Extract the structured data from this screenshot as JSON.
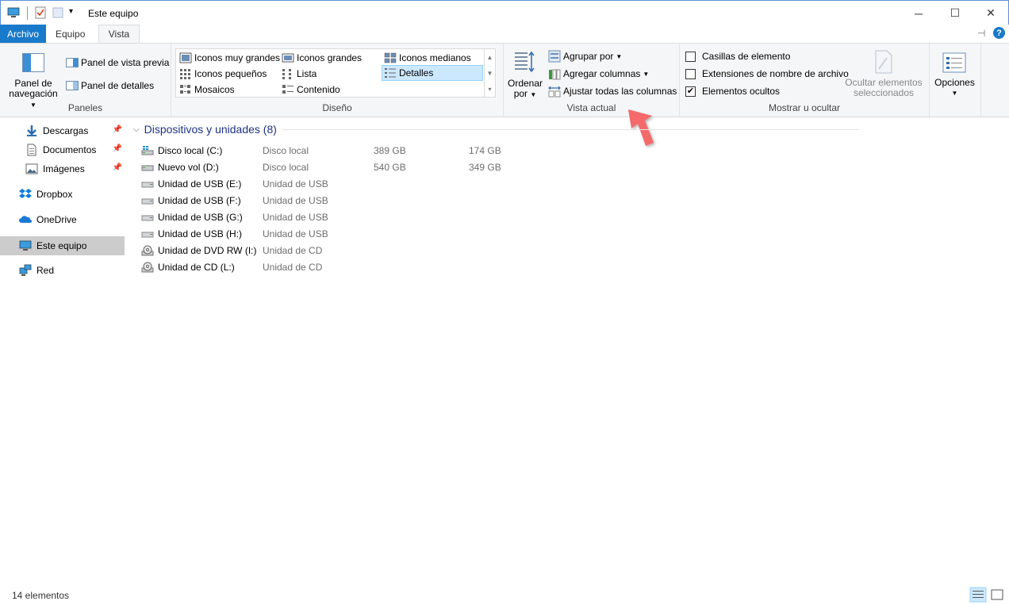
{
  "window": {
    "title": "Este equipo"
  },
  "tabs": [
    {
      "label": "Archivo"
    },
    {
      "label": "Equipo"
    },
    {
      "label": "Vista"
    }
  ],
  "ribbon": {
    "panes": {
      "nav_pane_label_1": "Panel de",
      "nav_pane_label_2": "navegación",
      "preview_pane": "Panel de vista previa",
      "details_pane": "Panel de detalles",
      "group_label": "Paneles"
    },
    "layout": {
      "items": [
        "Iconos muy grandes",
        "Iconos grandes",
        "Iconos medianos",
        "Iconos pequeños",
        "Lista",
        "Detalles",
        "Mosaicos",
        "Contenido"
      ],
      "selected": "Detalles",
      "group_label": "Diseño"
    },
    "current_view": {
      "sort_label_1": "Ordenar",
      "sort_label_2": "por",
      "group_by": "Agrupar por",
      "add_columns": "Agregar columnas",
      "fit_columns": "Ajustar todas las columnas",
      "group_label": "Vista actual"
    },
    "show_hide": {
      "item_checkboxes": {
        "label": "Casillas de elemento",
        "checked": false
      },
      "file_extensions": {
        "label": "Extensiones de nombre de archivo",
        "checked": false
      },
      "hidden_items": {
        "label": "Elementos ocultos",
        "checked": true
      },
      "hide_selected_1": "Ocultar elementos",
      "hide_selected_2": "seleccionados",
      "group_label": "Mostrar u ocultar"
    },
    "options": {
      "label": "Opciones"
    }
  },
  "nav": {
    "items": [
      {
        "label": "Descargas",
        "icon": "download-icon",
        "pinned": true
      },
      {
        "label": "Documentos",
        "icon": "document-icon",
        "pinned": true
      },
      {
        "label": "Imágenes",
        "icon": "image-icon",
        "pinned": true
      },
      {
        "label": "Dropbox",
        "icon": "dropbox-icon"
      },
      {
        "label": "OneDrive",
        "icon": "cloud-icon"
      },
      {
        "label": "Este equipo",
        "icon": "computer-icon",
        "selected": true
      },
      {
        "label": "Red",
        "icon": "network-icon"
      }
    ]
  },
  "content": {
    "group_title": "Dispositivos y unidades (8)",
    "drives": [
      {
        "name": "Disco local (C:)",
        "type": "Disco local",
        "total": "389 GB",
        "free": "174 GB",
        "icon": "windows-drive-icon"
      },
      {
        "name": "Nuevo vol (D:)",
        "type": "Disco local",
        "total": "540 GB",
        "free": "349 GB",
        "icon": "hard-drive-icon"
      },
      {
        "name": "Unidad de USB (E:)",
        "type": "Unidad de USB",
        "total": "",
        "free": "",
        "icon": "usb-drive-icon"
      },
      {
        "name": "Unidad de USB (F:)",
        "type": "Unidad de USB",
        "total": "",
        "free": "",
        "icon": "usb-drive-icon"
      },
      {
        "name": "Unidad de USB (G:)",
        "type": "Unidad de USB",
        "total": "",
        "free": "",
        "icon": "usb-drive-icon"
      },
      {
        "name": "Unidad de USB (H:)",
        "type": "Unidad de USB",
        "total": "",
        "free": "",
        "icon": "usb-drive-icon"
      },
      {
        "name": "Unidad de DVD RW (I:)",
        "type": "Unidad de CD",
        "total": "",
        "free": "",
        "icon": "dvd-drive-icon"
      },
      {
        "name": "Unidad de CD (L:)",
        "type": "Unidad de CD",
        "total": "",
        "free": "",
        "icon": "cd-drive-icon"
      }
    ]
  },
  "status": {
    "item_count": "14 elementos"
  },
  "colors": {
    "accent": "#1979ca",
    "selection": "#cce8ff",
    "group_title": "#1e3287",
    "arrow": "#f46a6a"
  }
}
